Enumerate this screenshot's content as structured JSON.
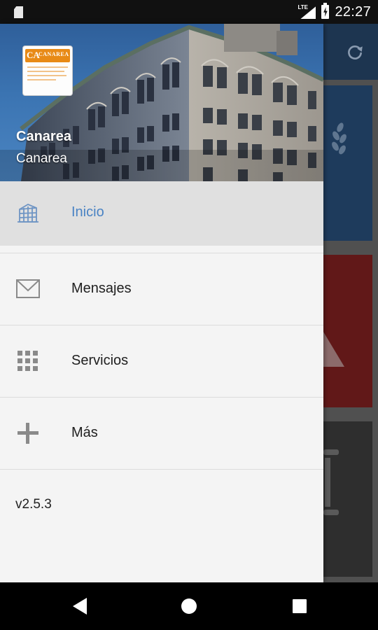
{
  "status_bar": {
    "network_label": "LTE",
    "time": "22:27",
    "icons": [
      "sd-card-icon",
      "lte-signal-icon",
      "battery-charging-icon"
    ]
  },
  "background_app": {
    "toolbar_icon": "refresh-icon",
    "card_colors": [
      "#1e3b5c",
      "#611818",
      "#2e2e2e"
    ]
  },
  "drawer": {
    "header": {
      "logo_text": "CANAREA",
      "logo_mark": "CA",
      "title": "Canarea",
      "subtitle": "Canarea"
    },
    "menu": [
      {
        "label": "Inicio",
        "icon": "building-icon",
        "active": true
      },
      {
        "label": "Mensajes",
        "icon": "mail-icon",
        "active": false
      },
      {
        "label": "Servicios",
        "icon": "grid-icon",
        "active": false
      },
      {
        "label": "Más",
        "icon": "plus-icon",
        "active": false
      }
    ],
    "version": "v2.5.3"
  },
  "nav_bar": {
    "buttons": [
      "back-icon",
      "home-icon",
      "recents-icon"
    ]
  },
  "colors": {
    "accent": "#4a83c4",
    "toolbar": "#1d3550",
    "drawer_bg": "#f4f4f4",
    "active_item_bg": "#e0e0e0"
  }
}
